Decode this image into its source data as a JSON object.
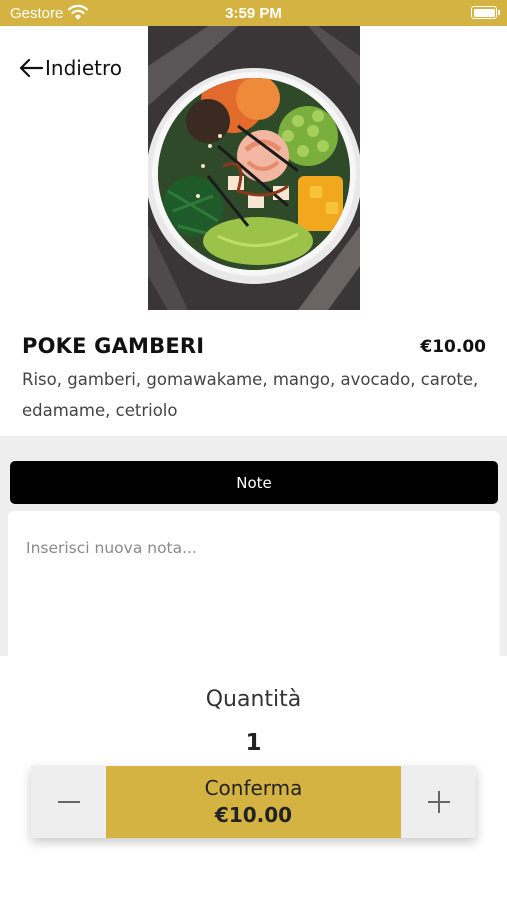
{
  "status_bar": {
    "carrier": "Gestore",
    "time": "3:59 PM"
  },
  "nav": {
    "back_label": "Indietro"
  },
  "dish": {
    "name": "POKE GAMBERI",
    "price": "€10.00",
    "description": "Riso, gamberi, gomawakame, mango, avocado, carote, edamame, cetriolo"
  },
  "notes": {
    "header": "Note",
    "placeholder": "Inserisci nuova nota...",
    "value": ""
  },
  "order": {
    "quantity_label": "Quantità",
    "quantity": "1",
    "confirm_label": "Conferma",
    "confirm_total": "€10.00"
  },
  "colors": {
    "accent": "#d4b343",
    "dark": "#000000",
    "panel": "#eeeeee"
  }
}
